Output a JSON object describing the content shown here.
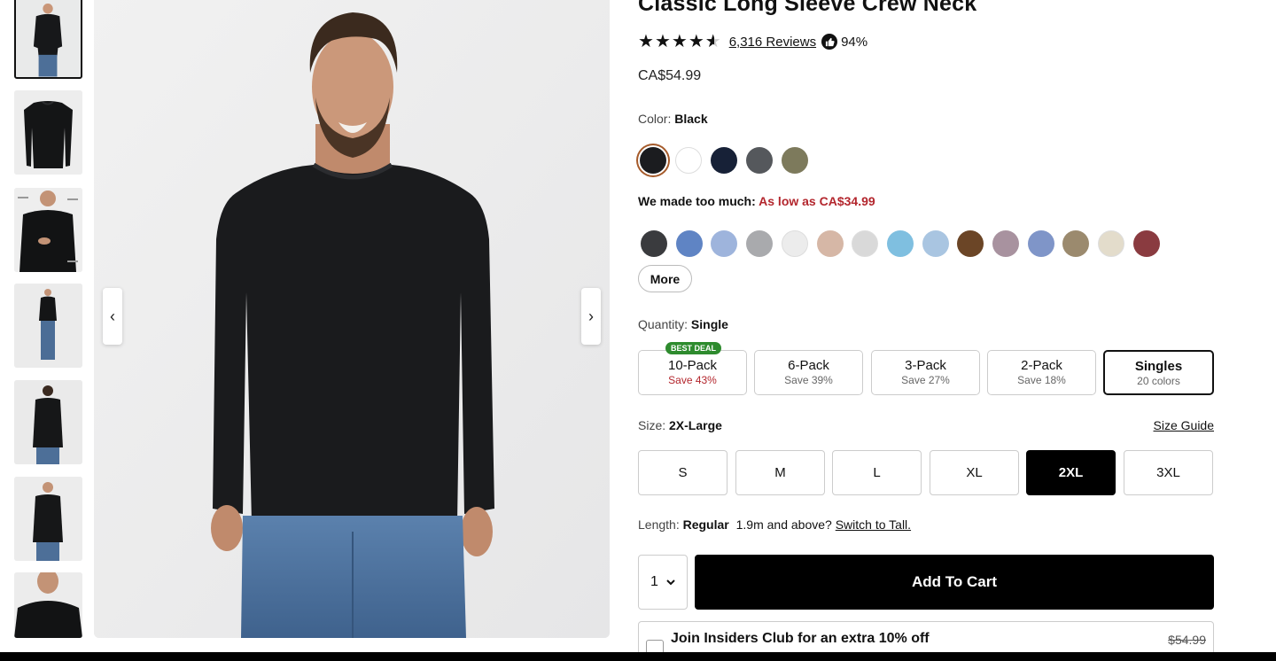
{
  "product": {
    "title": "Classic Long Sleeve Crew Neck",
    "reviews_label": "6,316 Reviews",
    "recommend_pct": "94%",
    "price": "CA$54.99",
    "rating": 4.5
  },
  "color": {
    "label": "Color:",
    "selected": "Black",
    "main_swatches": [
      {
        "name": "Black",
        "hex": "#1b1c1f"
      },
      {
        "name": "White",
        "hex": "#ffffff"
      },
      {
        "name": "Navy",
        "hex": "#172137"
      },
      {
        "name": "Charcoal",
        "hex": "#55585c"
      },
      {
        "name": "Olive",
        "hex": "#7d7a5c"
      }
    ],
    "promo_text": "We made too much:",
    "promo_price": "As low as CA$34.99",
    "clearance_swatches": [
      "#3a3b3e",
      "#5f84c4",
      "#9eb4dc",
      "#a9aaad",
      "#ececec",
      "#d6b7a6",
      "#d9d9d9",
      "#7fbfe0",
      "#a9c5e1",
      "#6b4526",
      "#a8929f",
      "#7f95c8",
      "#9b8a6e",
      "#e3dccb",
      "#8a3b40"
    ],
    "more_label": "More"
  },
  "quantity": {
    "label": "Quantity:",
    "selected": "Single",
    "best_deal": "BEST DEAL",
    "options": [
      {
        "name": "10-Pack",
        "sub": "Save 43%"
      },
      {
        "name": "6-Pack",
        "sub": "Save 39%"
      },
      {
        "name": "3-Pack",
        "sub": "Save 27%"
      },
      {
        "name": "2-Pack",
        "sub": "Save 18%"
      },
      {
        "name": "Singles",
        "sub": "20 colors"
      }
    ]
  },
  "size": {
    "label": "Size:",
    "selected": "2X-Large",
    "guide": "Size Guide",
    "options": [
      "S",
      "M",
      "L",
      "XL",
      "2XL",
      "3XL"
    ],
    "active": "2XL"
  },
  "length": {
    "label": "Length:",
    "value": "Regular",
    "note": "1.9m and above?",
    "link": "Switch to Tall."
  },
  "cart": {
    "qty": "1",
    "button": "Add To Cart"
  },
  "insiders": {
    "text": "Join Insiders Club for an extra 10% off",
    "old_price": "$54.99"
  },
  "colors": {
    "accent_ring": "#a55a2a",
    "sale_red": "#b3262d",
    "best_deal_green": "#2e8b2e"
  }
}
